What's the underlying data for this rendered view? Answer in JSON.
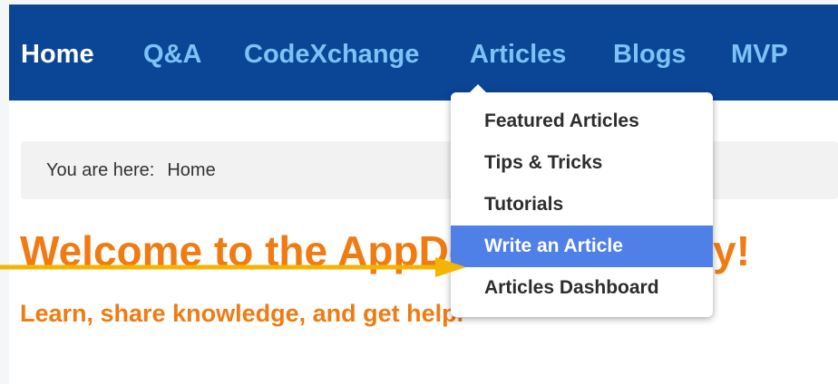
{
  "nav": {
    "items": [
      {
        "label": "Home",
        "active": true
      },
      {
        "label": "Q&A",
        "active": false
      },
      {
        "label": "CodeXchange",
        "active": false
      },
      {
        "label": "Articles",
        "active": false
      },
      {
        "label": "Blogs",
        "active": false
      },
      {
        "label": "MVP",
        "active": false
      }
    ]
  },
  "breadcrumb": {
    "prefix": "You are here:",
    "current": "Home"
  },
  "hero": {
    "title": "Welcome to the AppDev Community!",
    "subtitle": "Learn, share knowledge, and get help."
  },
  "articles_menu": {
    "items": [
      {
        "label": "Featured Articles",
        "highlighted": false
      },
      {
        "label": "Tips & Tricks",
        "highlighted": false
      },
      {
        "label": "Tutorials",
        "highlighted": false
      },
      {
        "label": "Write an Article",
        "highlighted": true
      },
      {
        "label": "Articles Dashboard",
        "highlighted": false
      }
    ]
  },
  "colors": {
    "nav_background": "#0b4595",
    "nav_text": "#7cc2f6",
    "nav_active_text": "#ffffff",
    "heading_orange": "#f07b12",
    "menu_highlight": "#4f80e8",
    "annotation_arrow": "#f5b400"
  },
  "icons": {
    "annotation": "arrow-right-icon"
  }
}
